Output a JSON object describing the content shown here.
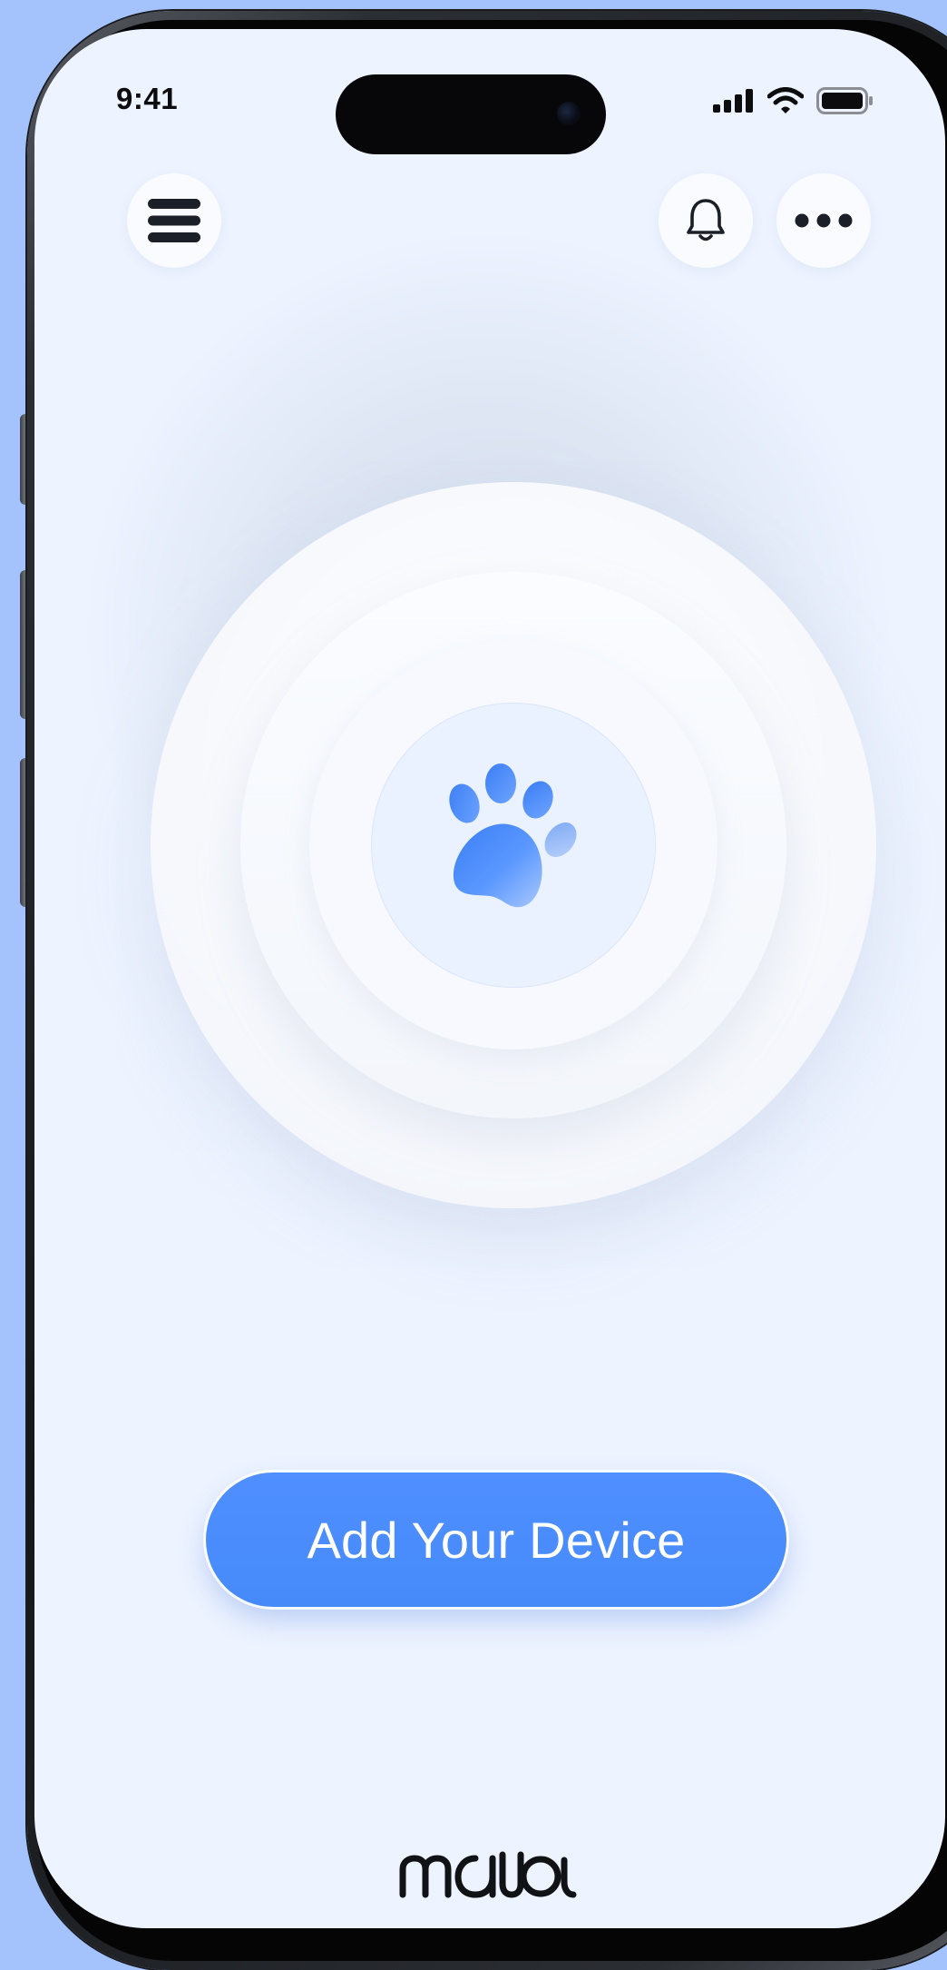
{
  "status_bar": {
    "time": "9:41",
    "icons": [
      "cellular-signal-icon",
      "wifi-icon",
      "battery-icon"
    ]
  },
  "header": {
    "buttons": [
      "menu-icon",
      "bell-icon",
      "more-dots-icon"
    ]
  },
  "scanner": {
    "center_icon": "paw-icon"
  },
  "cta": {
    "label": "Add Your Device"
  },
  "brand": {
    "logo_text": "mallow"
  },
  "colors": {
    "background": "#a4c3fd",
    "screen": "#edf3ff",
    "accent": "#468af9",
    "text_dark": "#1b1f27"
  }
}
